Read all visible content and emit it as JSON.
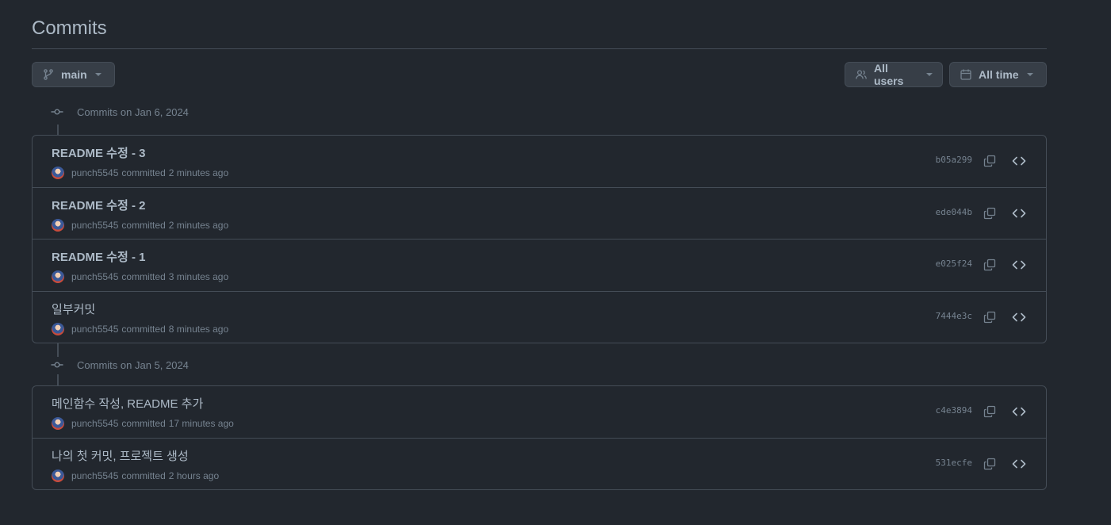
{
  "page": {
    "title": "Commits"
  },
  "toolbar": {
    "branch_label": "main",
    "users_label": "All users",
    "time_label": "All time"
  },
  "groups": [
    {
      "heading": "Commits on Jan 6, 2024",
      "commits": [
        {
          "message": "README 수정 - 3",
          "author": "punch5545",
          "committed": "committed",
          "when": "2 minutes ago",
          "sha": "b05a299"
        },
        {
          "message": "README 수정 - 2",
          "author": "punch5545",
          "committed": "committed",
          "when": "2 minutes ago",
          "sha": "ede044b"
        },
        {
          "message": "README 수정 - 1",
          "author": "punch5545",
          "committed": "committed",
          "when": "3 minutes ago",
          "sha": "e025f24"
        },
        {
          "message": "일부커밋",
          "author": "punch5545",
          "committed": "committed",
          "when": "8 minutes ago",
          "sha": "7444e3c"
        }
      ]
    },
    {
      "heading": "Commits on Jan 5, 2024",
      "commits": [
        {
          "message": "메인함수 작성, README 추가",
          "author": "punch5545",
          "committed": "committed",
          "when": "17 minutes ago",
          "sha": "c4e3894"
        },
        {
          "message": "나의 첫 커밋, 프로젝트 생성",
          "author": "punch5545",
          "committed": "committed",
          "when": "2 hours ago",
          "sha": "531ecfe"
        }
      ]
    }
  ],
  "icons": {
    "branch": "git-branch-icon",
    "users": "people-icon",
    "calendar": "calendar-icon",
    "commit": "git-commit-icon",
    "copy": "copy-icon",
    "browse": "code-icon"
  },
  "colors": {
    "background": "#22272e",
    "border": "#444c56",
    "text": "#adbac7",
    "muted": "#768390"
  }
}
